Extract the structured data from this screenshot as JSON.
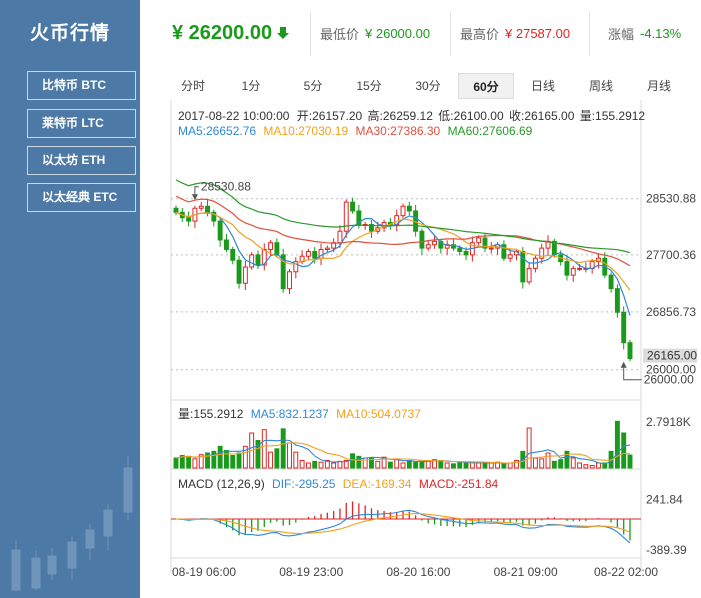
{
  "sidebar": {
    "title": "火币行情",
    "coins": [
      {
        "label": "比特币 BTC",
        "active": true
      },
      {
        "label": "莱特币 LTC",
        "active": false
      },
      {
        "label": "以太坊 ETH",
        "active": false
      },
      {
        "label": "以太经典 ETC",
        "active": false
      }
    ]
  },
  "header": {
    "price": "¥ 26200.00",
    "trend_icon": "arrow-down-icon",
    "low_label": "最低价",
    "low_value": "¥ 26000.00",
    "high_label": "最高价",
    "high_value": "¥ 27587.00",
    "change_label": "涨幅",
    "change_value": "-4.13%"
  },
  "tabs": [
    {
      "label": "分时",
      "active": false
    },
    {
      "label": "1分",
      "active": false
    },
    {
      "label": "5分",
      "active": false
    },
    {
      "label": "15分",
      "active": false
    },
    {
      "label": "30分",
      "active": false
    },
    {
      "label": "60分",
      "active": true
    },
    {
      "label": "日线",
      "active": false
    },
    {
      "label": "周线",
      "active": false
    },
    {
      "label": "月线",
      "active": false
    }
  ],
  "colors": {
    "up": "#e02424",
    "down": "#1a9a1a",
    "ma5": "#2f88d8",
    "ma10": "#f0a020",
    "ma30": "#e05040",
    "ma60": "#2a9a2a",
    "sidebar": "#4d79a6"
  },
  "chart_data": {
    "type": "candlestick",
    "info": {
      "datetime": "2017-08-22 10:00:00",
      "open": "开:26157.20",
      "high": "高:26259.12",
      "low": "低:26100.00",
      "close": "收:26165.00",
      "volume": "量:155.2912"
    },
    "ma_legend": [
      {
        "name": "MA5",
        "text": "MA5:26652.76",
        "color": "#2f88d8"
      },
      {
        "name": "MA10",
        "text": "MA10:27030.19",
        "color": "#f0a020"
      },
      {
        "name": "MA30",
        "text": "MA30:27386.30",
        "color": "#e05040"
      },
      {
        "name": "MA60",
        "text": "MA60:27606.69",
        "color": "#2a9a2a"
      }
    ],
    "price_ticks": [
      "28530.88",
      "27700.36",
      "26856.73",
      "26000.00"
    ],
    "price_range": [
      25700,
      29400
    ],
    "last_price_tag": "26165.00",
    "max_marker": "28530.88",
    "min_marker": "26000.00",
    "volume_legend": [
      {
        "text": "量:155.2912",
        "color": "#333333"
      },
      {
        "text": "MA5:832.1237",
        "color": "#2f88d8"
      },
      {
        "text": "MA10:504.0737",
        "color": "#f0a020"
      }
    ],
    "volume_tick": "2.7918K",
    "macd_legend": [
      {
        "text": "MACD (12,26,9)",
        "color": "#333333"
      },
      {
        "text": "DIF:-295.25",
        "color": "#2f88d8"
      },
      {
        "text": "DEA:-169.34",
        "color": "#f0a020"
      },
      {
        "text": "MACD:-251.84",
        "color": "#e02424"
      }
    ],
    "macd_ticks": [
      "241.84",
      "-389.39"
    ],
    "macd_range": [
      -450,
      300
    ],
    "x_labels": [
      "08-19 06:00",
      "08-19 23:00",
      "08-20 16:00",
      "08-21 09:00",
      "08-22 02:00"
    ],
    "x_label_index": [
      0,
      17,
      34,
      51,
      68
    ],
    "closes": [
      28330,
      28250,
      28200,
      28390,
      28420,
      28330,
      28200,
      27920,
      27780,
      27620,
      27280,
      27520,
      27700,
      27550,
      27780,
      27880,
      27700,
      27200,
      27450,
      27600,
      27680,
      27750,
      27650,
      27780,
      27800,
      27880,
      28050,
      28480,
      28350,
      28150,
      28150,
      28050,
      28100,
      28180,
      28150,
      28280,
      28420,
      28350,
      28050,
      27800,
      27850,
      27900,
      27800,
      27850,
      27800,
      27750,
      27700,
      27880,
      27950,
      27800,
      27800,
      27850,
      27650,
      27700,
      27750,
      27300,
      27500,
      27650,
      27800,
      27900,
      27700,
      27600,
      27400,
      27500,
      27500,
      27500,
      27600,
      27650,
      27400,
      27200,
      26850,
      26400,
      26165
    ],
    "volumes": [
      120,
      150,
      140,
      110,
      160,
      180,
      200,
      260,
      210,
      150,
      180,
      260,
      420,
      330,
      460,
      190,
      230,
      470,
      300,
      190,
      90,
      60,
      80,
      70,
      90,
      60,
      80,
      90,
      170,
      140,
      120,
      120,
      80,
      130,
      70,
      100,
      60,
      90,
      70,
      80,
      90,
      100,
      90,
      60,
      50,
      70,
      60,
      70,
      60,
      55,
      60,
      70,
      50,
      60,
      90,
      200,
      480,
      120,
      110,
      180,
      80,
      100,
      200,
      120,
      60,
      40,
      30,
      60,
      60,
      200,
      560,
      420,
      155
    ]
  }
}
